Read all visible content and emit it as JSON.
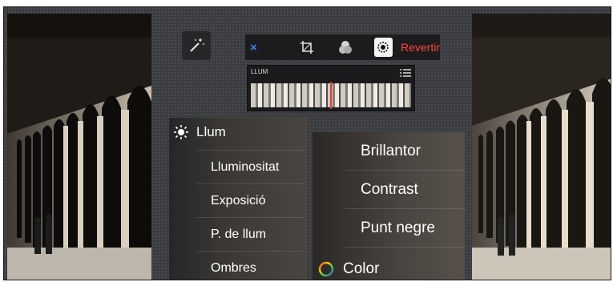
{
  "toolbar": {
    "close_label": "×",
    "revert_label": "Revertir",
    "icons": [
      "crop-icon",
      "filters-icon",
      "adjust-icon"
    ],
    "active_icon": "adjust-icon"
  },
  "strip": {
    "label": "LLUM"
  },
  "light_menu": {
    "header": "Llum",
    "items": [
      "Lluminositat",
      "Exposició",
      "P. de llum",
      "Ombres"
    ]
  },
  "submenu": {
    "items": [
      "Brillantor",
      "Contrast",
      "Punt negre"
    ],
    "color_label": "Color"
  },
  "colors": {
    "accent_blue": "#3a86ff",
    "revert_red": "#ff453a",
    "marker_red": "#e03a2f"
  }
}
